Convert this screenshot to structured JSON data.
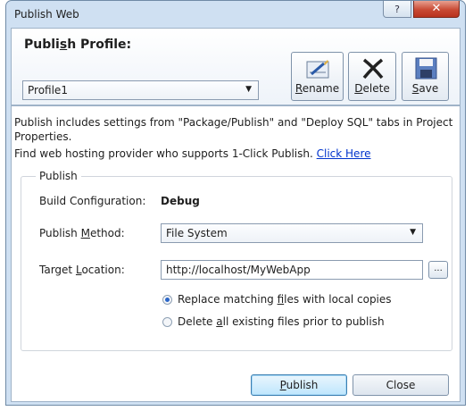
{
  "window": {
    "title": "Publish Web",
    "help_glyph": "?",
    "close_glyph": "✕"
  },
  "header": {
    "profile_title_pre": "Publi",
    "profile_title_key": "s",
    "profile_title_post": "h Profile:",
    "profile_value": "Profile1",
    "rename_key": "R",
    "rename_rest": "ename",
    "delete_key": "D",
    "delete_rest": "elete",
    "save_key": "S",
    "save_rest": "ave"
  },
  "body": {
    "description": "Publish includes settings from \"Package/Publish\" and \"Deploy SQL\" tabs in Project Properties.",
    "find_text": "Find web hosting provider who supports 1-Click Publish.",
    "find_link": "Click Here",
    "group_legend": "Publish",
    "build_config_label": "Build Configuration:",
    "build_config_value": "Debug",
    "method_label_pre": "Publish ",
    "method_label_key": "M",
    "method_label_post": "ethod:",
    "method_value": "File System",
    "target_label_pre": "Target ",
    "target_label_key": "L",
    "target_label_post": "ocation:",
    "target_value": "http://localhost/MyWebApp",
    "browse_label": "...",
    "radio1_pre": "Replace matching ",
    "radio1_key": "f",
    "radio1_post": "iles with local copies",
    "radio2_pre": "Delete ",
    "radio2_key": "a",
    "radio2_post": "ll existing files prior to publish"
  },
  "footer": {
    "publish_key": "P",
    "publish_rest": "ublish",
    "close_label": "Close"
  }
}
